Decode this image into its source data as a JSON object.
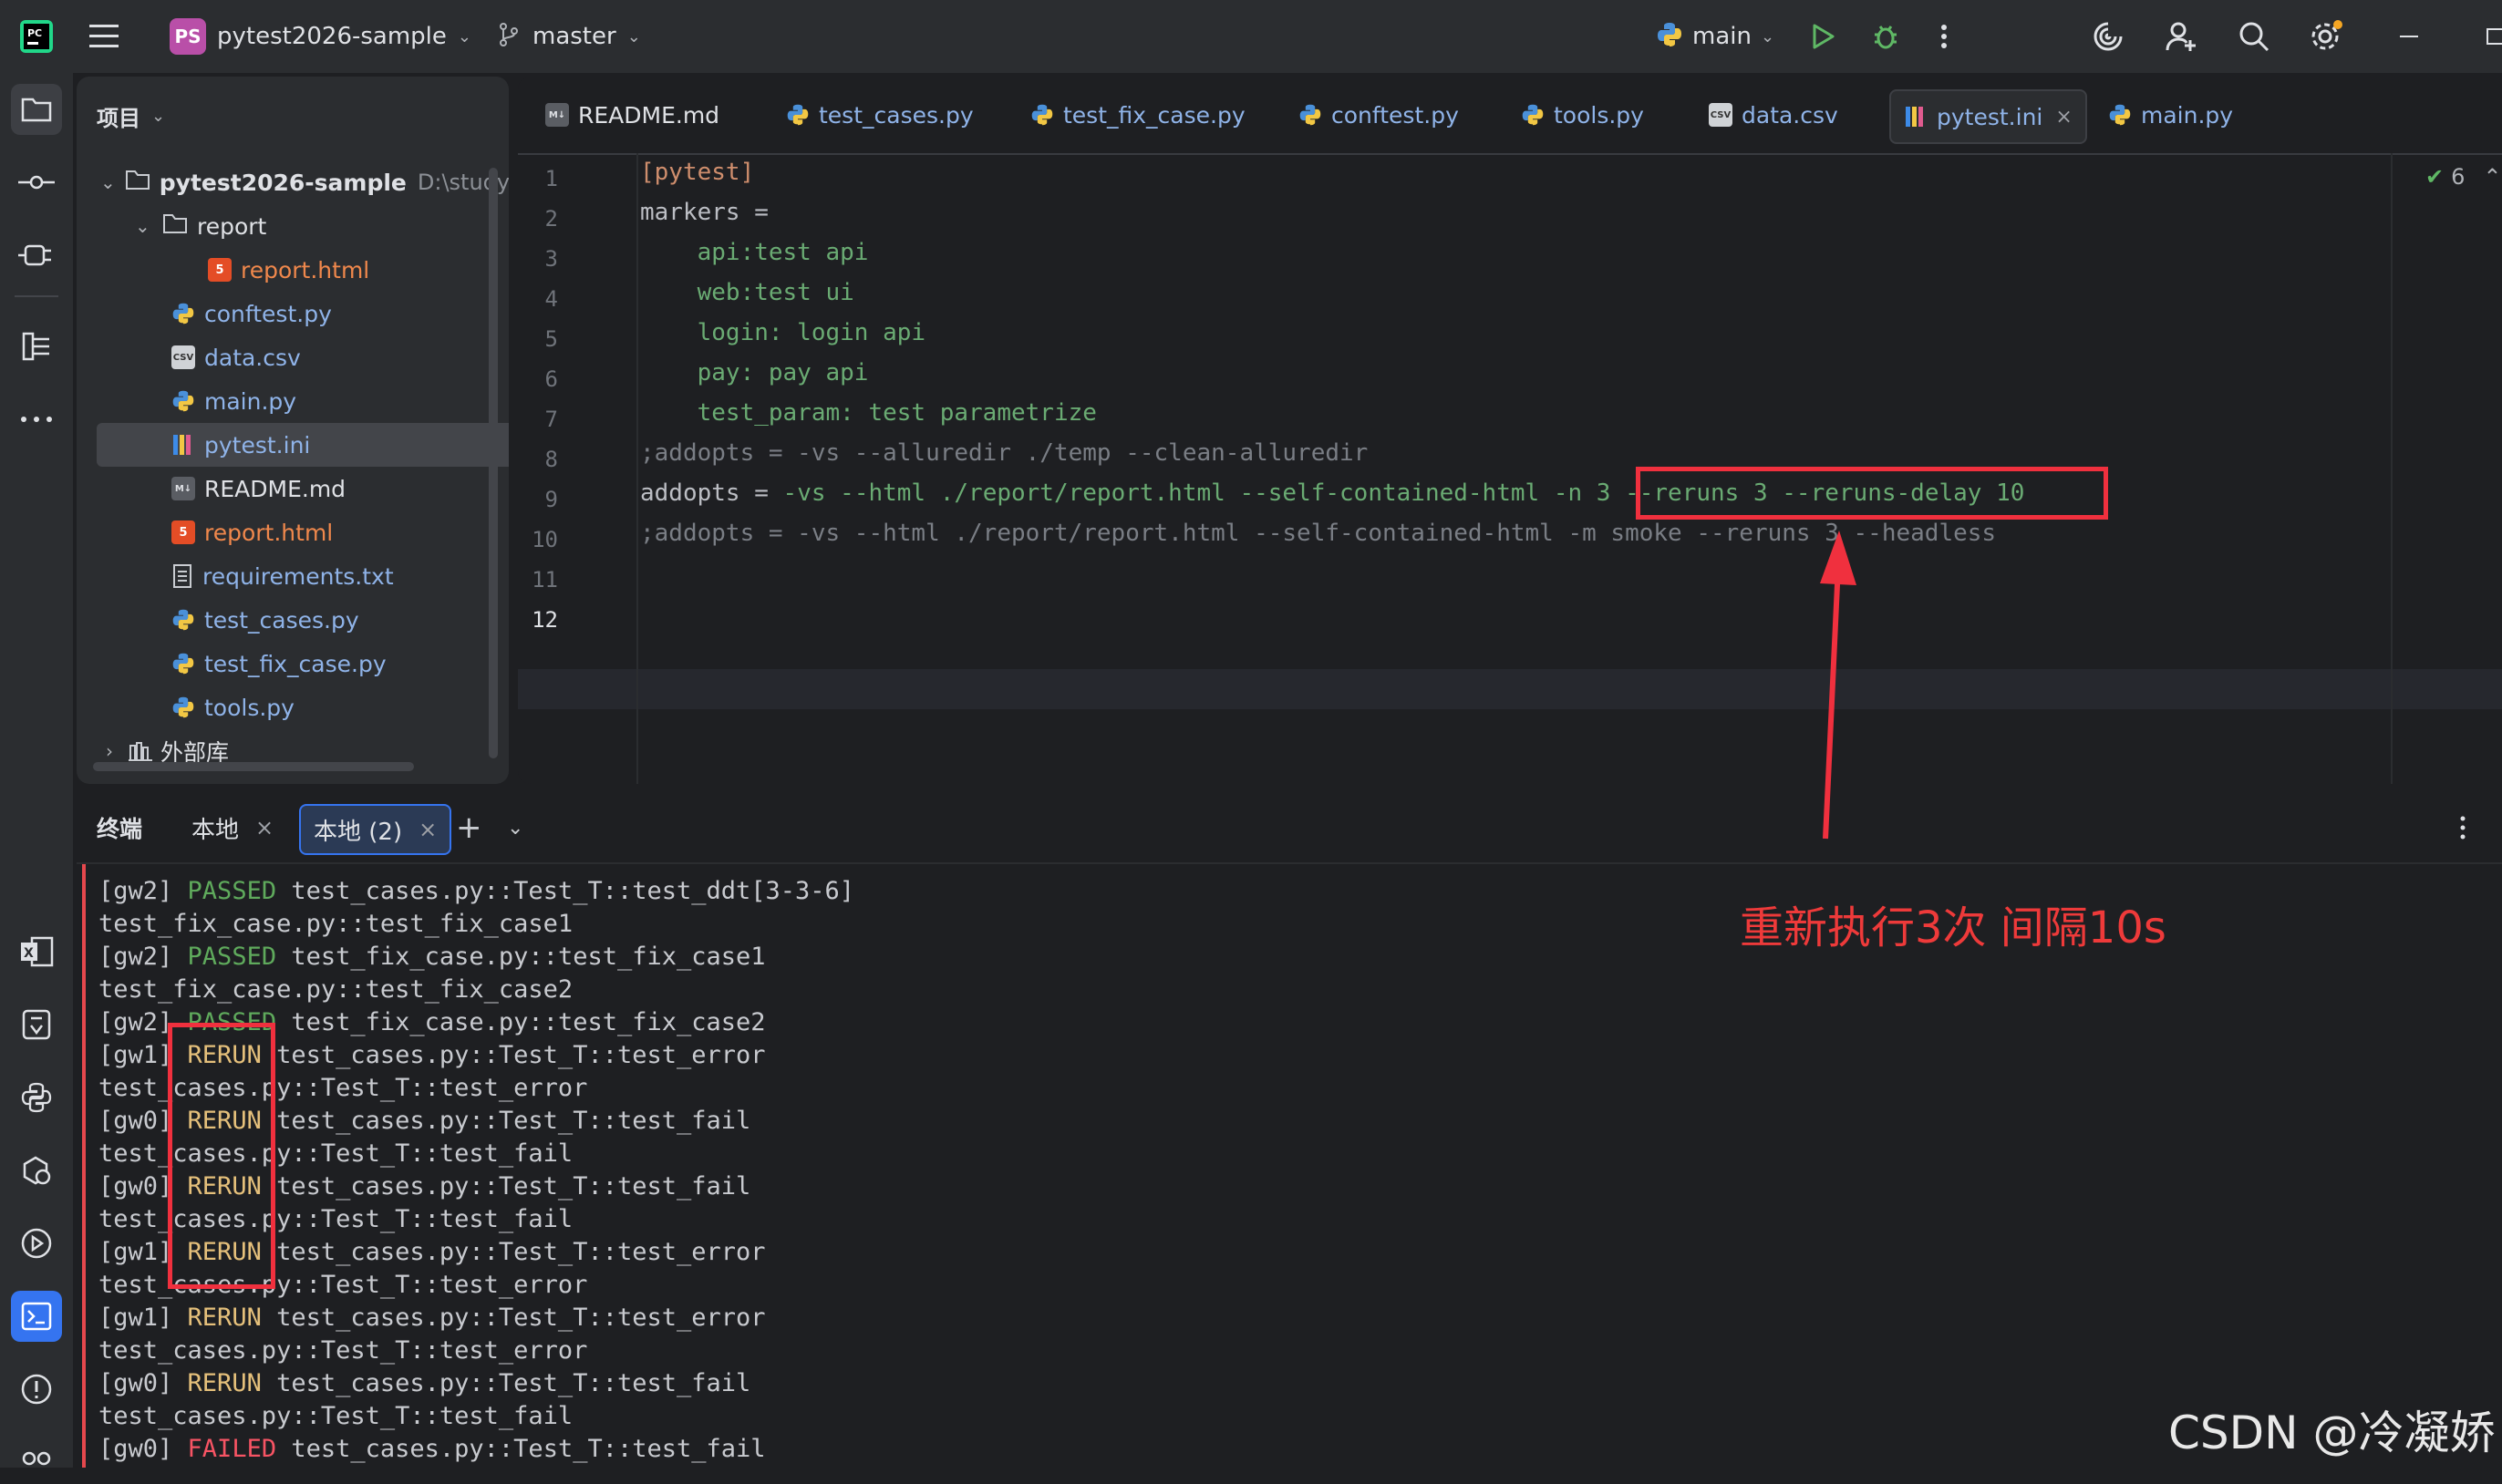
{
  "titlebar": {
    "project_badge": "PS",
    "project_name": "pytest2026-sample",
    "branch": "master",
    "run_config": "main"
  },
  "project_panel": {
    "title": "项目",
    "root_name": "pytest2026-sample",
    "root_path": "D:\\study\\py",
    "items": [
      {
        "label": "report",
        "icon": "folder-icon"
      },
      {
        "label": "report.html",
        "icon": "html-file-icon"
      },
      {
        "label": "conftest.py",
        "icon": "python-file-icon"
      },
      {
        "label": "data.csv",
        "icon": "csv-file-icon"
      },
      {
        "label": "main.py",
        "icon": "python-file-icon"
      },
      {
        "label": "pytest.ini",
        "icon": "ini-file-icon"
      },
      {
        "label": "README.md",
        "icon": "markdown-file-icon"
      },
      {
        "label": "report.html",
        "icon": "html-file-icon"
      },
      {
        "label": "requirements.txt",
        "icon": "text-file-icon"
      },
      {
        "label": "test_cases.py",
        "icon": "python-file-icon"
      },
      {
        "label": "test_fix_case.py",
        "icon": "python-file-icon"
      },
      {
        "label": "tools.py",
        "icon": "python-file-icon"
      },
      {
        "label": "外部库",
        "icon": "library-icon"
      }
    ]
  },
  "editor": {
    "tabs": [
      "README.md",
      "test_cases.py",
      "test_fix_case.py",
      "conftest.py",
      "tools.py",
      "data.csv",
      "pytest.ini",
      "main.py"
    ],
    "active_tab": "pytest.ini",
    "inspection_count": "6",
    "line_numbers": [
      "1",
      "2",
      "3",
      "4",
      "5",
      "6",
      "7",
      "8",
      "9",
      "10",
      "11",
      "12"
    ],
    "lines": {
      "l1": "[pytest]",
      "l2": "markers =",
      "l3": "    api:test api",
      "l4": "    web:test ui",
      "l5": "    login: login api",
      "l6": "    pay: pay api",
      "l7": "    test_param: test parametrize",
      "l8": ";addopts = -vs --alluredir ./temp --clean-alluredir",
      "l9a": "addopts",
      "l9b": " = ",
      "l9c": "-vs --html ./report/report.html --self-contained-html -n 3 --reruns 3 --reruns-delay 10",
      "l10": ";addopts = -vs --html ./report/report.html --self-contained-html -m smoke --reruns 3 --headless",
      "l11": "",
      "l12": ""
    }
  },
  "terminal": {
    "title": "终端",
    "tabs": [
      "本地",
      "本地 (2)"
    ],
    "lines": [
      {
        "pre": "[gw2] ",
        "status": "PASSED",
        "cls": "g",
        "rest": " test_cases.py::Test_T::test_ddt[3-3-6]"
      },
      {
        "pre": "test_fix_case.py::test_fix_case1",
        "status": "",
        "cls": "",
        "rest": ""
      },
      {
        "pre": "[gw2] ",
        "status": "PASSED",
        "cls": "g",
        "rest": " test_fix_case.py::test_fix_case1"
      },
      {
        "pre": "test_fix_case.py::test_fix_case2",
        "status": "",
        "cls": "",
        "rest": ""
      },
      {
        "pre": "[gw2] ",
        "status": "PASSED",
        "cls": "g",
        "rest": " test_fix_case.py::test_fix_case2"
      },
      {
        "pre": "[gw1] ",
        "status": "RERUN",
        "cls": "y",
        "rest": " test_cases.py::Test_T::test_error"
      },
      {
        "pre": "test_cases.py::Test_T::test_error",
        "status": "",
        "cls": "",
        "rest": ""
      },
      {
        "pre": "[gw0] ",
        "status": "RERUN",
        "cls": "y",
        "rest": " test_cases.py::Test_T::test_fail"
      },
      {
        "pre": "test_cases.py::Test_T::test_fail",
        "status": "",
        "cls": "",
        "rest": ""
      },
      {
        "pre": "[gw0] ",
        "status": "RERUN",
        "cls": "y",
        "rest": " test_cases.py::Test_T::test_fail"
      },
      {
        "pre": "test_cases.py::Test_T::test_fail",
        "status": "",
        "cls": "",
        "rest": ""
      },
      {
        "pre": "[gw1] ",
        "status": "RERUN",
        "cls": "y",
        "rest": " test_cases.py::Test_T::test_error"
      },
      {
        "pre": "test_cases.py::Test_T::test_error",
        "status": "",
        "cls": "",
        "rest": ""
      },
      {
        "pre": "[gw1] ",
        "status": "RERUN",
        "cls": "y",
        "rest": " test_cases.py::Test_T::test_error"
      },
      {
        "pre": "test_cases.py::Test_T::test_error",
        "status": "",
        "cls": "",
        "rest": ""
      },
      {
        "pre": "[gw0] ",
        "status": "RERUN",
        "cls": "y",
        "rest": " test_cases.py::Test_T::test_fail"
      },
      {
        "pre": "test_cases.py::Test_T::test_fail",
        "status": "",
        "cls": "",
        "rest": ""
      },
      {
        "pre": "[gw0] ",
        "status": "FAILED",
        "cls": "r",
        "rest": " test_cases.py::Test_T::test_fail"
      }
    ]
  },
  "annotation": {
    "note": "重新执行3次 间隔10s",
    "color": "#f0303e"
  },
  "watermark": "CSDN @冷凝娇"
}
